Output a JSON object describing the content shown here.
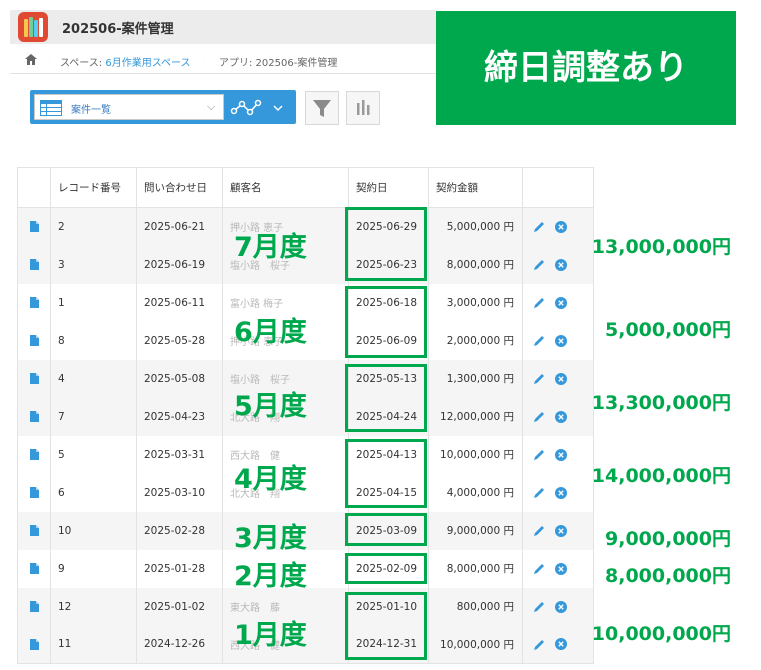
{
  "header": {
    "app_title": "202506-案件管理"
  },
  "breadcrumb": {
    "space_prefix": "スペース: ",
    "space_link": "6月作業用スペース",
    "app": "アプリ: 202506-案件管理"
  },
  "toolbar": {
    "view_label": "案件一覧",
    "view_caret": "⌵"
  },
  "banner": {
    "text": "締日調整あり"
  },
  "columns": [
    "レコード番号",
    "問い合わせ日",
    "顧客名",
    "契約日",
    "契約金額"
  ],
  "rows": [
    {
      "no": "2",
      "inquiry": "2025-06-21",
      "customer": "押小路 恵子",
      "contract": "2025-06-29",
      "amount": "5,000,000 円"
    },
    {
      "no": "3",
      "inquiry": "2025-06-19",
      "customer": "塩小路　桜子",
      "contract": "2025-06-23",
      "amount": "8,000,000 円"
    },
    {
      "no": "1",
      "inquiry": "2025-06-11",
      "customer": "富小路 梅子",
      "contract": "2025-06-18",
      "amount": "3,000,000 円"
    },
    {
      "no": "8",
      "inquiry": "2025-05-28",
      "customer": "押小路 恵子",
      "contract": "2025-06-09",
      "amount": "2,000,000 円"
    },
    {
      "no": "4",
      "inquiry": "2025-05-08",
      "customer": "塩小路　桜子",
      "contract": "2025-05-13",
      "amount": "1,300,000 円"
    },
    {
      "no": "7",
      "inquiry": "2025-04-23",
      "customer": "北大路　翔",
      "contract": "2025-04-24",
      "amount": "12,000,000 円"
    },
    {
      "no": "5",
      "inquiry": "2025-03-31",
      "customer": "西大路　健",
      "contract": "2025-04-13",
      "amount": "10,000,000 円"
    },
    {
      "no": "6",
      "inquiry": "2025-03-10",
      "customer": "北大路　翔",
      "contract": "2025-04-15",
      "amount": "4,000,000 円"
    },
    {
      "no": "10",
      "inquiry": "2025-02-28",
      "customer": "",
      "contract": "2025-03-09",
      "amount": "9,000,000 円"
    },
    {
      "no": "9",
      "inquiry": "2025-01-28",
      "customer": "",
      "contract": "2025-02-09",
      "amount": "8,000,000 円"
    },
    {
      "no": "12",
      "inquiry": "2025-01-02",
      "customer": "東大路　藤",
      "contract": "2025-01-10",
      "amount": "800,000 円"
    },
    {
      "no": "11",
      "inquiry": "2024-12-26",
      "customer": "西大路　健",
      "contract": "2024-12-31",
      "amount": "10,000,000 円"
    }
  ],
  "periods": [
    "7月度",
    "6月度",
    "5月度",
    "4月度",
    "3月度",
    "2月度",
    "1月度"
  ],
  "totals": [
    "13,000,000円",
    "5,000,000円",
    "13,300,000円",
    "14,000,000円",
    "9,000,000円",
    "8,000,000円",
    "10,000,000円"
  ],
  "colors": {
    "accent_green": "#00a84d",
    "kintone_blue": "#3498db",
    "header_bg": "#ececec"
  }
}
